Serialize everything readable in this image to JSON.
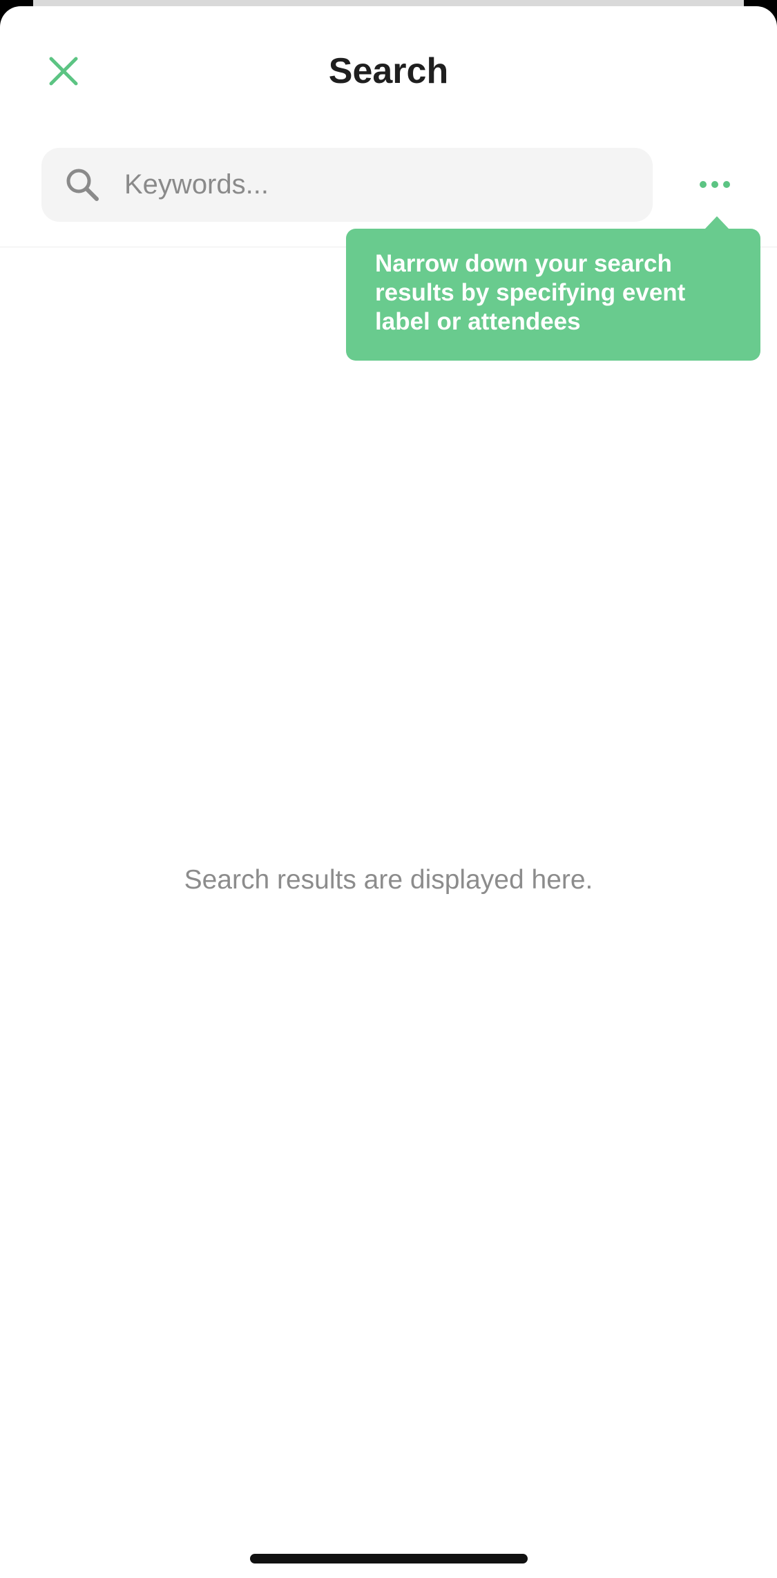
{
  "header": {
    "title": "Search",
    "close_icon": "close-icon"
  },
  "search": {
    "placeholder": "Keywords...",
    "value": "",
    "icon": "search-icon",
    "more_icon": "more-horizontal-icon"
  },
  "tooltip": {
    "text": "Narrow down your search results by specifying event label or attendees"
  },
  "results": {
    "empty_message": "Search results are displayed here."
  },
  "colors": {
    "accent": "#5cc483",
    "tooltip_bg": "#69cb8e",
    "title": "#1f1f1f",
    "muted_text": "#8c8c8c",
    "search_bg": "#f4f4f4"
  }
}
